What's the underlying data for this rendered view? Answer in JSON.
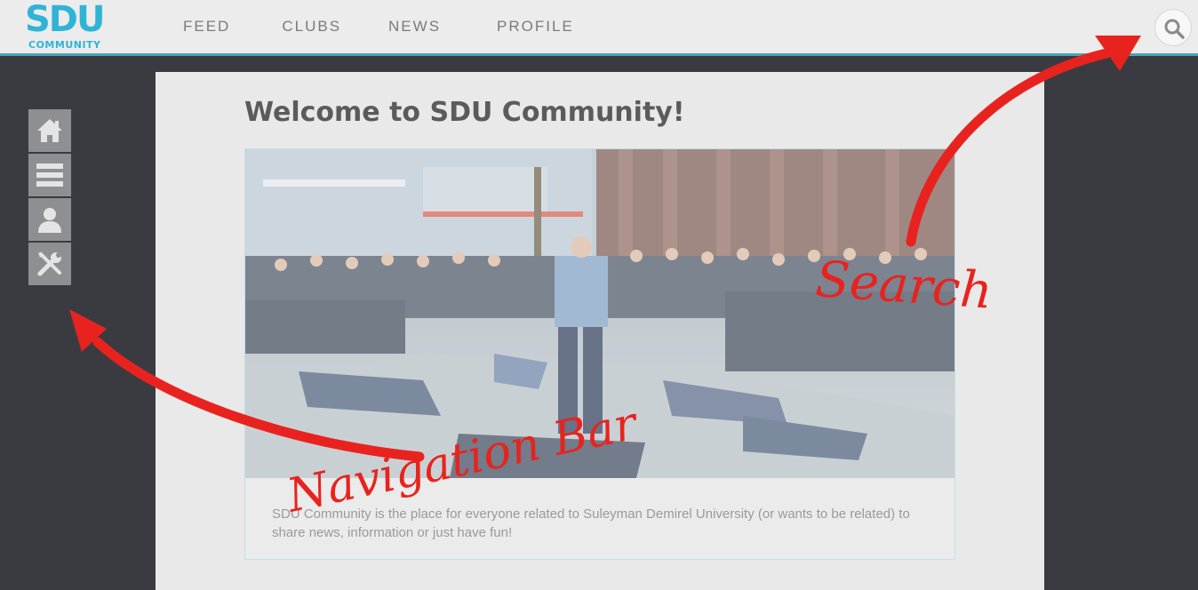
{
  "header": {
    "logo_main": "SDU",
    "logo_sub": "COMMUNITY",
    "nav": [
      "FEED",
      "CLUBS",
      "NEWS",
      "PROFILE"
    ],
    "search_icon": "search-icon"
  },
  "sidebar": {
    "items": [
      {
        "icon": "home-icon"
      },
      {
        "icon": "menu-icon"
      },
      {
        "icon": "user-icon"
      },
      {
        "icon": "tools-icon"
      }
    ]
  },
  "main": {
    "title": "Welcome to SDU Community!",
    "description": "SDU Community is the place for everyone related to Suleyman Demirel University (or wants to be related) to share news, information or just have fun!"
  },
  "annotations": {
    "search": "Search",
    "navigation": "Navigation Bar"
  },
  "colors": {
    "accent": "#2fb4d6",
    "annotation": "#e8231f",
    "background": "#3a3b41"
  }
}
